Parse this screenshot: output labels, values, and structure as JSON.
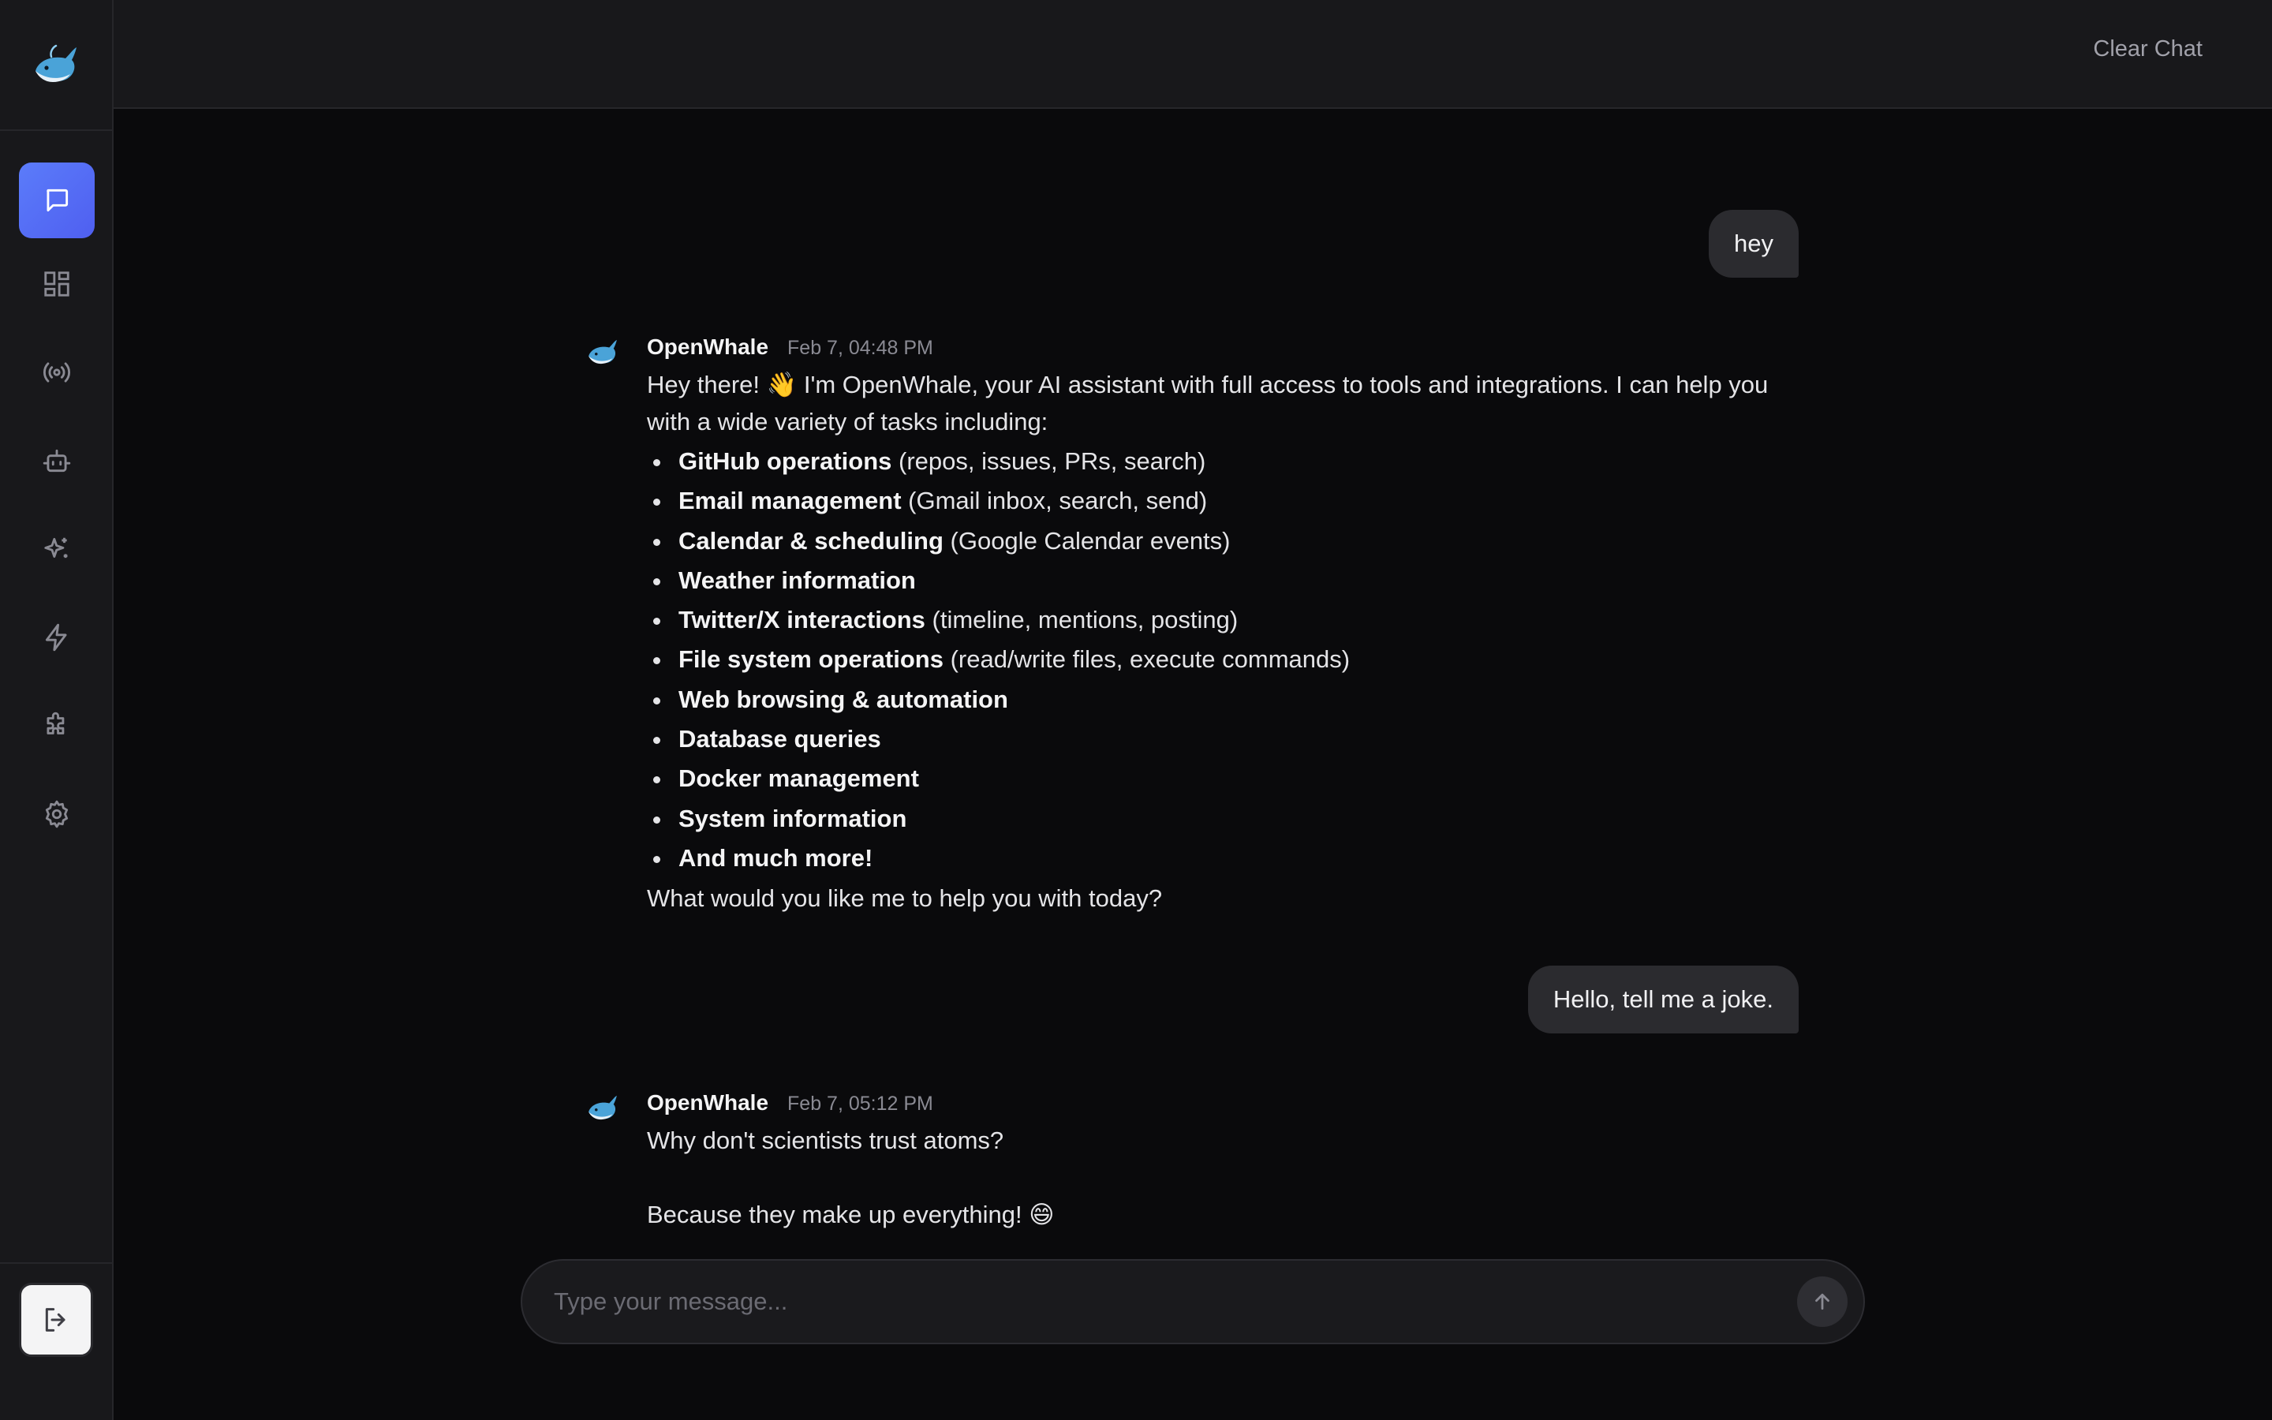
{
  "header": {
    "clear_chat_label": "Clear Chat"
  },
  "sidebar": {
    "logo": "openwhale-logo",
    "items": [
      {
        "name": "chat",
        "icon": "chat-bubble-icon",
        "active": true
      },
      {
        "name": "dashboard",
        "icon": "grid-icon",
        "active": false
      },
      {
        "name": "channels",
        "icon": "broadcast-icon",
        "active": false
      },
      {
        "name": "agents",
        "icon": "robot-icon",
        "active": false
      },
      {
        "name": "skills",
        "icon": "sparkles-icon",
        "active": false
      },
      {
        "name": "automations",
        "icon": "lightning-icon",
        "active": false
      },
      {
        "name": "extensions",
        "icon": "puzzle-icon",
        "active": false
      },
      {
        "name": "settings",
        "icon": "gear-icon",
        "active": false
      }
    ],
    "logout_icon": "logout-icon"
  },
  "messages": {
    "user1": {
      "text": "hey"
    },
    "assistant1": {
      "name": "OpenWhale",
      "time": "Feb 7, 04:48 PM",
      "intro": "Hey there! 👋 I'm OpenWhale, your AI assistant with full access to tools and integrations. I can help you with a wide variety of tasks including:",
      "features": [
        {
          "bold": "GitHub operations",
          "rest": " (repos, issues, PRs, search)"
        },
        {
          "bold": "Email management",
          "rest": " (Gmail inbox, search, send)"
        },
        {
          "bold": "Calendar & scheduling",
          "rest": " (Google Calendar events)"
        },
        {
          "bold": "Weather information",
          "rest": ""
        },
        {
          "bold": "Twitter/X interactions",
          "rest": " (timeline, mentions, posting)"
        },
        {
          "bold": "File system operations",
          "rest": " (read/write files, execute commands)"
        },
        {
          "bold": "Web browsing & automation",
          "rest": ""
        },
        {
          "bold": "Database queries",
          "rest": ""
        },
        {
          "bold": "Docker management",
          "rest": ""
        },
        {
          "bold": "System information",
          "rest": ""
        },
        {
          "bold": "And much more!",
          "rest": ""
        }
      ],
      "outro": "What would you like me to help you with today?"
    },
    "user2": {
      "text": "Hello, tell me a joke."
    },
    "assistant2": {
      "name": "OpenWhale",
      "time": "Feb 7, 05:12 PM",
      "line1": "Why don't scientists trust atoms?",
      "line2": "Because they make up everything! 😄"
    }
  },
  "composer": {
    "placeholder": "Type your message...",
    "value": ""
  },
  "colors": {
    "accent": "#5b7cfa",
    "background": "#0a0a0c",
    "sidebar": "#18181b",
    "bubble": "#2b2b2f"
  }
}
